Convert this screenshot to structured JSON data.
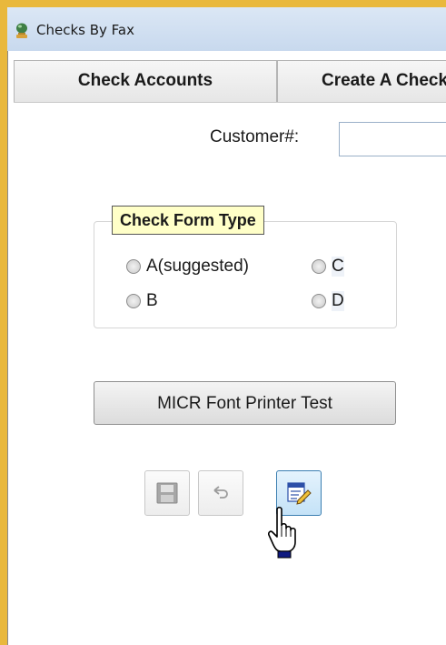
{
  "window": {
    "title": "Checks By Fax",
    "app_icon": "globe-trophy-icon"
  },
  "tabs": [
    {
      "label": "Check Accounts"
    },
    {
      "label": "Create A Check"
    }
  ],
  "customer": {
    "label": "Customer#:",
    "value": ""
  },
  "check_form_type": {
    "legend": "Check Form Type",
    "options": [
      {
        "label": "A(suggested)",
        "selected": false
      },
      {
        "label": "C",
        "selected": false
      },
      {
        "label": "B",
        "selected": false
      },
      {
        "label": "D",
        "selected": false
      }
    ]
  },
  "micr_button": {
    "label": "MICR Font Printer Test"
  },
  "toolbar": [
    {
      "icon": "save-icon",
      "enabled": false
    },
    {
      "icon": "undo-icon",
      "enabled": false
    },
    {
      "icon": "edit-icon",
      "enabled": true
    }
  ],
  "colors": {
    "frame": "#e9b83c",
    "legend_bg": "#ffffc8",
    "titlebar": "#d3e1f2"
  }
}
